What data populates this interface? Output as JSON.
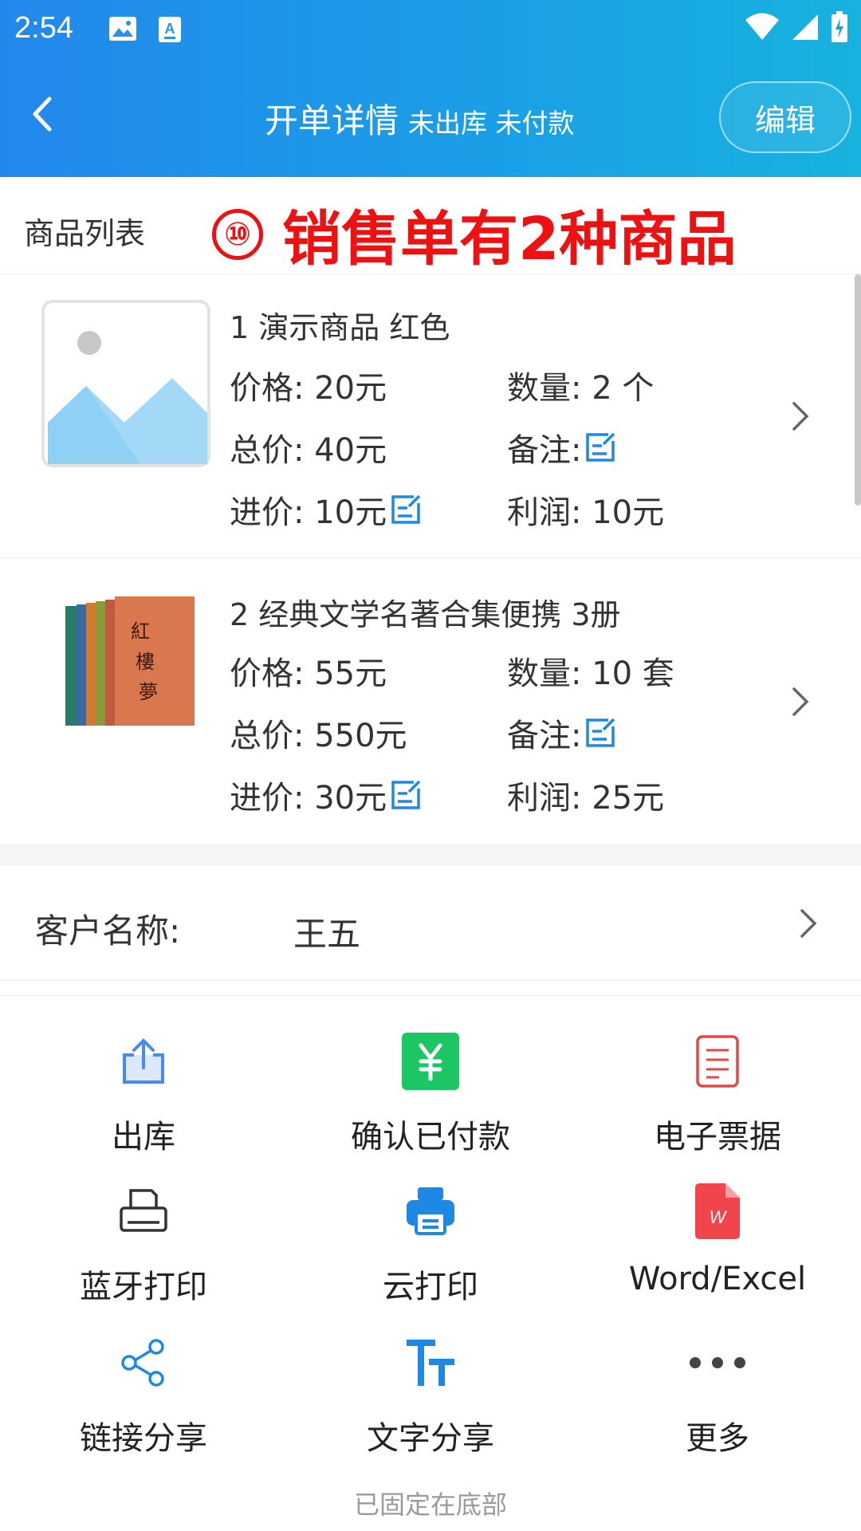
{
  "status_bar": {
    "time": "2:54"
  },
  "nav": {
    "title": "开单详情",
    "subtitle": "未出库 未付款",
    "edit_label": "编辑"
  },
  "product_section": {
    "title": "商品列表",
    "annotation_number": "⑩",
    "annotation_text": "销售单有2种商品"
  },
  "products": [
    {
      "name": "1 演示商品 红色",
      "price": "价格: 20元",
      "quantity": "数量: 2 个",
      "total": "总价: 40元",
      "note": "备注:",
      "cost": "进价: 10元",
      "profit": "利润: 10元"
    },
    {
      "name": "2 经典文学名著合集便携 3册",
      "price": "价格: 55元",
      "quantity": "数量: 10 套",
      "total": "总价: 550元",
      "note": "备注:",
      "cost": "进价: 30元",
      "profit": "利润: 25元"
    }
  ],
  "customer": {
    "label": "客户名称:",
    "value": "王五"
  },
  "actions": [
    {
      "label": "出库",
      "icon": "upload-icon"
    },
    {
      "label": "确认已付款",
      "icon": "yen-payment-icon"
    },
    {
      "label": "电子票据",
      "icon": "receipt-icon"
    },
    {
      "label": "蓝牙打印",
      "icon": "printer-outline-icon"
    },
    {
      "label": "云打印",
      "icon": "printer-filled-icon"
    },
    {
      "label": "Word/Excel",
      "icon": "document-file-icon"
    },
    {
      "label": "链接分享",
      "icon": "share-icon"
    },
    {
      "label": "文字分享",
      "icon": "text-icon"
    },
    {
      "label": "更多",
      "icon": "more-icon"
    }
  ],
  "footer": {
    "note": "已固定在底部"
  },
  "colors": {
    "header_start": "#2388ec",
    "header_end": "#17b2de",
    "accent_blue": "#1e88e5",
    "annotation_red": "#ee1111",
    "pay_green": "#1cc664"
  }
}
